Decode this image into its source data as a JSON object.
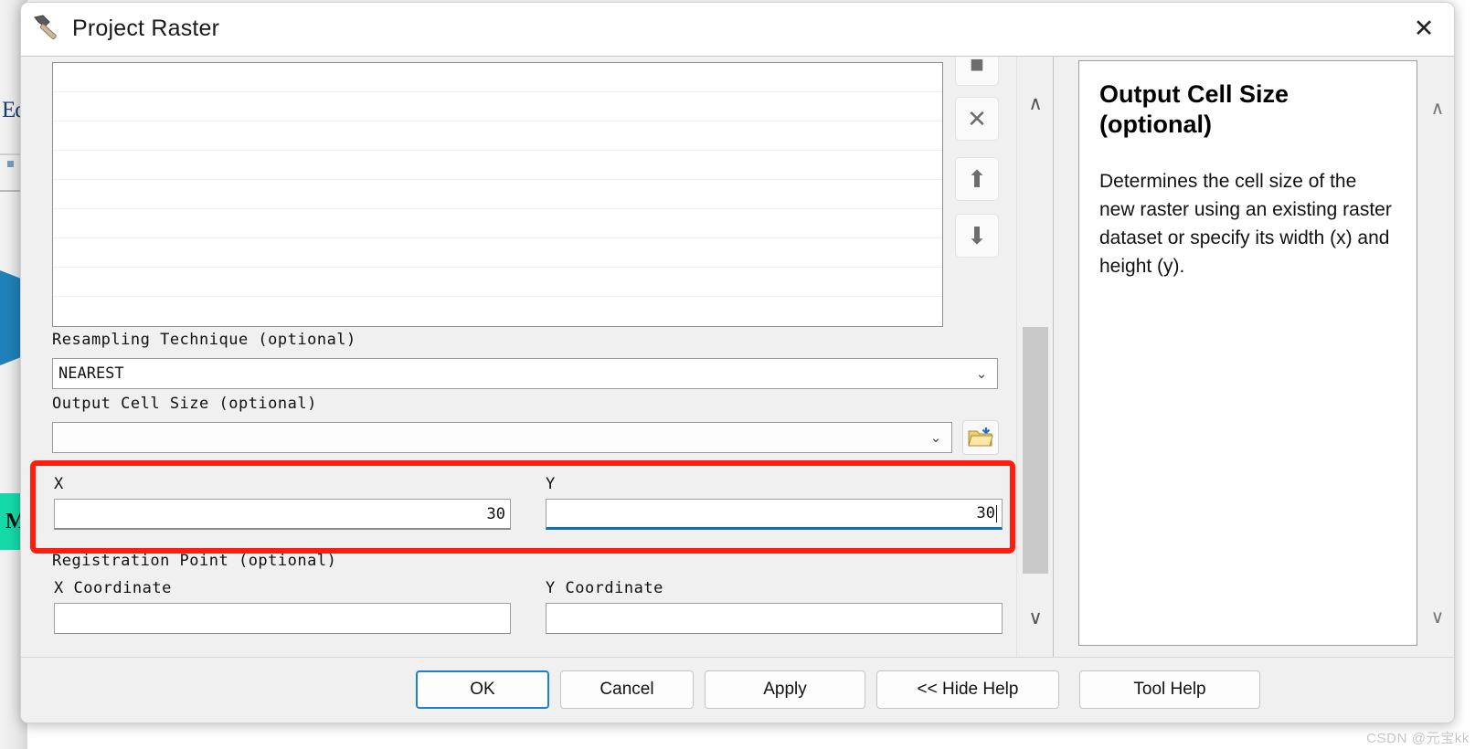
{
  "window": {
    "title": "Project Raster",
    "icon": "hammer-icon",
    "close_label": "✕"
  },
  "background": {
    "edit_text": "Ed",
    "teal_letter": "M"
  },
  "list": {
    "row_count": 8,
    "buttons": [
      {
        "name": "add-button",
        "glyph": "■"
      },
      {
        "name": "remove-button",
        "glyph": "✕"
      },
      {
        "name": "move-up-button",
        "glyph": "⬆"
      },
      {
        "name": "move-down-button",
        "glyph": "⬇"
      }
    ]
  },
  "fields": {
    "resampling": {
      "label": "Resampling Technique (optional)",
      "value": "NEAREST",
      "arrow": "⌄"
    },
    "output_cell_size": {
      "label": "Output Cell Size (optional)",
      "value": "",
      "arrow": "⌄",
      "browse_icon": "folder-open-icon"
    },
    "x": {
      "label": "X",
      "value": "30"
    },
    "y": {
      "label": "Y",
      "value": "30",
      "focused": true
    },
    "registration_point": {
      "label": "Registration Point (optional)"
    },
    "x_coordinate": {
      "label": "X Coordinate",
      "value": ""
    },
    "y_coordinate": {
      "label": "Y Coordinate",
      "value": ""
    }
  },
  "scrollbars": {
    "param_up": "∧",
    "param_down": "∨",
    "help_up": "∧",
    "help_down": "∨"
  },
  "help": {
    "title": "Output Cell Size (optional)",
    "body": "Determines the cell size of the new raster using an existing raster dataset or specify its width (x) and height (y)."
  },
  "footer": {
    "ok": "OK",
    "cancel": "Cancel",
    "apply": "Apply",
    "hide_help": "<< Hide Help",
    "tool_help": "Tool Help"
  },
  "watermark": "CSDN @元宝kk",
  "colors": {
    "highlight_red": "#ff1d0d",
    "focus_blue": "#0d6fc4",
    "default_button_blue": "#1b7fd4",
    "dialog_bg": "#f0f0f0",
    "background_blue_shape": "#1f7fb8",
    "background_teal_shape": "#14d9a8"
  }
}
